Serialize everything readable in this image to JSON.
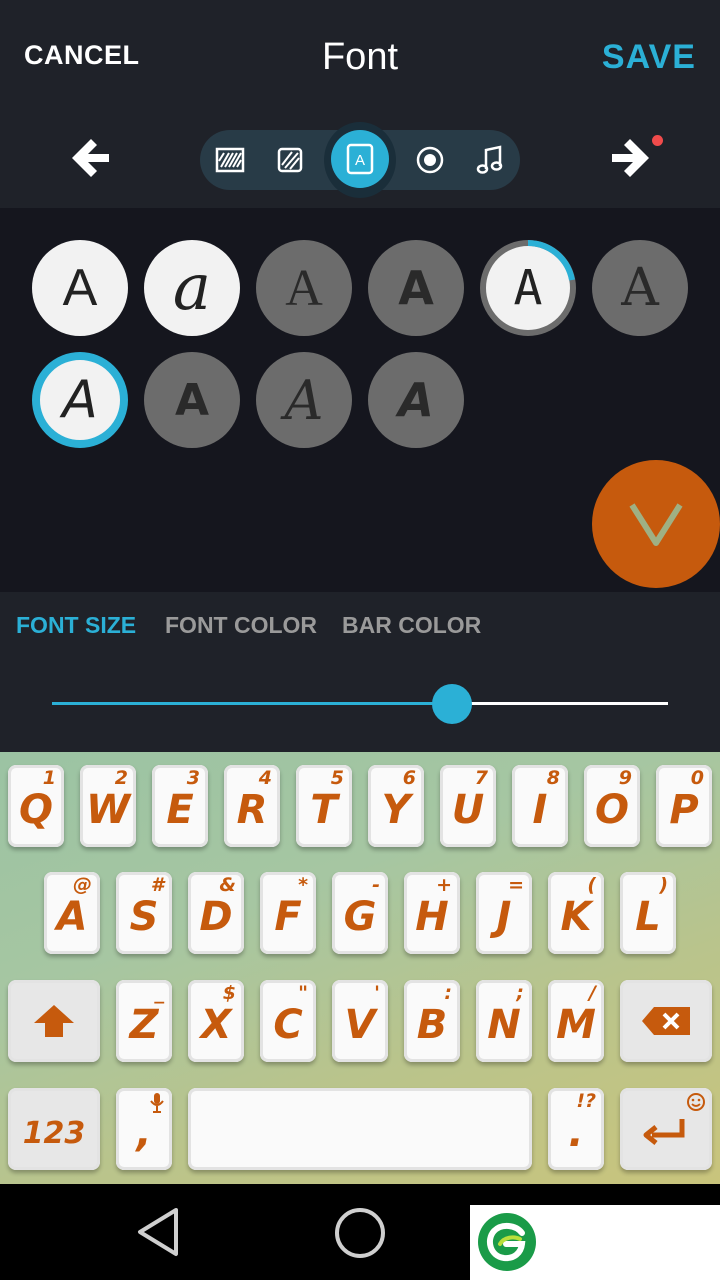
{
  "header": {
    "cancel_label": "CANCEL",
    "title": "Font",
    "save_label": "SAVE"
  },
  "steps": [
    {
      "icon": "background-pattern-icon"
    },
    {
      "icon": "texture-icon"
    },
    {
      "icon": "font-icon",
      "label": "A"
    },
    {
      "icon": "effect-circle-icon"
    },
    {
      "icon": "music-note-icon"
    }
  ],
  "fonts": {
    "row1": [
      "A",
      "a",
      "A",
      "A",
      "A",
      "A"
    ],
    "row2": [
      "A",
      "A",
      "A",
      "A"
    ]
  },
  "options": {
    "tabs": [
      "FONT SIZE",
      "FONT COLOR",
      "BAR COLOR"
    ],
    "active_tab": "FONT SIZE",
    "font_size_fraction": 0.65
  },
  "keyboard": {
    "row1": [
      {
        "key": "Q",
        "hint": "1"
      },
      {
        "key": "W",
        "hint": "2"
      },
      {
        "key": "E",
        "hint": "3"
      },
      {
        "key": "R",
        "hint": "4"
      },
      {
        "key": "T",
        "hint": "5"
      },
      {
        "key": "Y",
        "hint": "6"
      },
      {
        "key": "U",
        "hint": "7"
      },
      {
        "key": "I",
        "hint": "8"
      },
      {
        "key": "O",
        "hint": "9"
      },
      {
        "key": "P",
        "hint": "0"
      }
    ],
    "row2": [
      {
        "key": "A",
        "hint": "@"
      },
      {
        "key": "S",
        "hint": "#"
      },
      {
        "key": "D",
        "hint": "&"
      },
      {
        "key": "F",
        "hint": "*"
      },
      {
        "key": "G",
        "hint": "-"
      },
      {
        "key": "H",
        "hint": "+"
      },
      {
        "key": "J",
        "hint": "="
      },
      {
        "key": "K",
        "hint": "("
      },
      {
        "key": "L",
        "hint": ")"
      }
    ],
    "row3": [
      {
        "key": "Z",
        "hint": "_"
      },
      {
        "key": "X",
        "hint": "$"
      },
      {
        "key": "C",
        "hint": "\""
      },
      {
        "key": "V",
        "hint": "'"
      },
      {
        "key": "B",
        "hint": ":"
      },
      {
        "key": "N",
        "hint": ";"
      },
      {
        "key": "M",
        "hint": "/"
      }
    ],
    "numbers_label": "123",
    "comma": ",",
    "period": ".",
    "period_hint": "!?"
  },
  "colors": {
    "accent": "#2bb0d6",
    "confirm": "#c65a0d",
    "key_text": "#c65a0d",
    "notification": "#f04b4b"
  }
}
